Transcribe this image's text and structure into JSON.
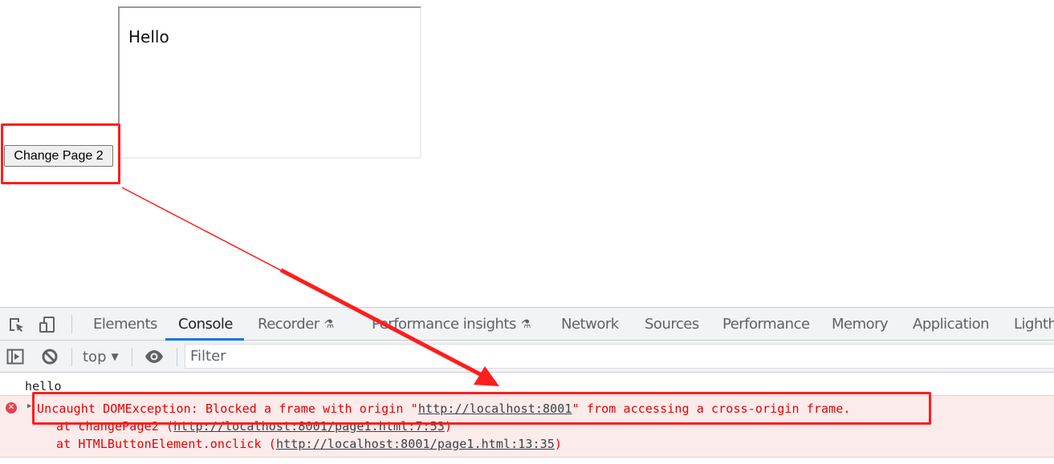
{
  "page": {
    "iframe_text": "Hello",
    "button_label": "Change Page 2"
  },
  "devtools": {
    "tabs": [
      {
        "label": "Elements",
        "active": false
      },
      {
        "label": "Console",
        "active": true
      },
      {
        "label": "Recorder",
        "active": false,
        "experimental": true
      },
      {
        "label": "Performance insights",
        "active": false,
        "experimental": true
      },
      {
        "label": "Network",
        "active": false
      },
      {
        "label": "Sources",
        "active": false
      },
      {
        "label": "Performance",
        "active": false
      },
      {
        "label": "Memory",
        "active": false
      },
      {
        "label": "Application",
        "active": false
      },
      {
        "label": "Lighth",
        "active": false
      }
    ],
    "toolbar": {
      "context": "top",
      "filter_placeholder": "Filter"
    },
    "console": {
      "log": "hello",
      "error": {
        "prefix": "Uncaught DOMException: Blocked a frame with origin \"",
        "origin_link": "http://localhost:8001",
        "suffix": "\" from accessing a cross-origin frame.",
        "stack": [
          {
            "prefix": "at changePage2 (",
            "link": "http://localhost:8001/page1.html:7:53",
            "suffix": ")"
          },
          {
            "prefix": "at HTMLButtonElement.onclick (",
            "link": "http://localhost:8001/page1.html:13:35",
            "suffix": ")"
          }
        ]
      }
    }
  },
  "annotation": {
    "color": "#ff1d1d"
  }
}
